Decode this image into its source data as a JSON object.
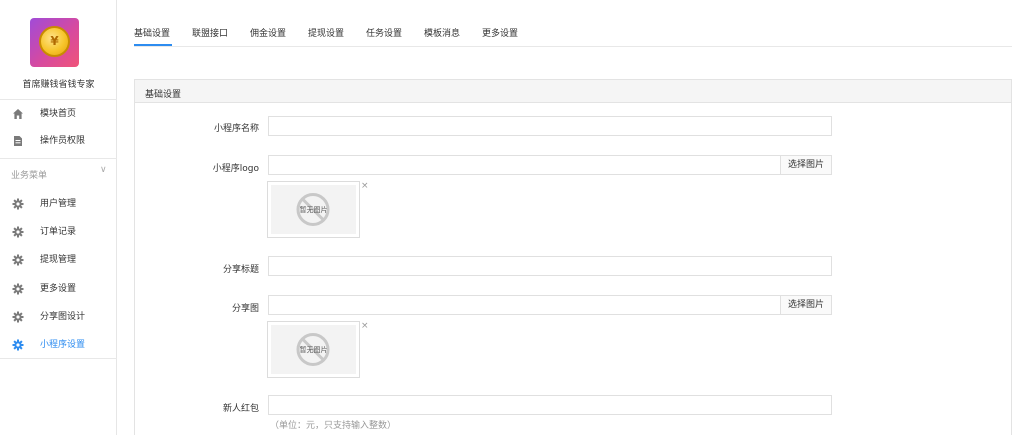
{
  "sidebar": {
    "app_name": "首席赚钱省钱专家",
    "logo_symbol": "¥",
    "top_items": [
      {
        "label": "模块首页",
        "icon": "home-icon"
      },
      {
        "label": "操作员权限",
        "icon": "document-icon"
      }
    ],
    "group": {
      "title": "业务菜单",
      "chevron": "∨"
    },
    "group_items": [
      {
        "label": "用户管理",
        "icon": "gear-icon"
      },
      {
        "label": "订单记录",
        "icon": "gear-icon"
      },
      {
        "label": "提现管理",
        "icon": "gear-icon"
      },
      {
        "label": "更多设置",
        "icon": "gear-icon"
      },
      {
        "label": "分享图设计",
        "icon": "gear-icon"
      },
      {
        "label": "小程序设置",
        "icon": "gear-icon",
        "active": true
      }
    ]
  },
  "tabs": [
    "基础设置",
    "联盟接口",
    "佣金设置",
    "提现设置",
    "任务设置",
    "模板消息",
    "更多设置"
  ],
  "active_tab": "基础设置",
  "panel": {
    "title": "基础设置",
    "fields": {
      "name_label": "小程序名称",
      "name_value": "",
      "logo_label": "小程序logo",
      "logo_value": "",
      "logo_button": "选择图片",
      "share_title_label": "分享标题",
      "share_title_value": "",
      "share_image_label": "分享图",
      "share_image_value": "",
      "share_image_button": "选择图片",
      "redpack_label": "新人红包",
      "redpack_value": "",
      "redpack_hint": "（单位：元，只支持输入整数）"
    },
    "no_image_text": "暂无图片",
    "remove_symbol": "×"
  },
  "colors": {
    "accent": "#2d8cf0",
    "icon_gray": "#7a7a7a",
    "border": "#e0e0e0"
  }
}
